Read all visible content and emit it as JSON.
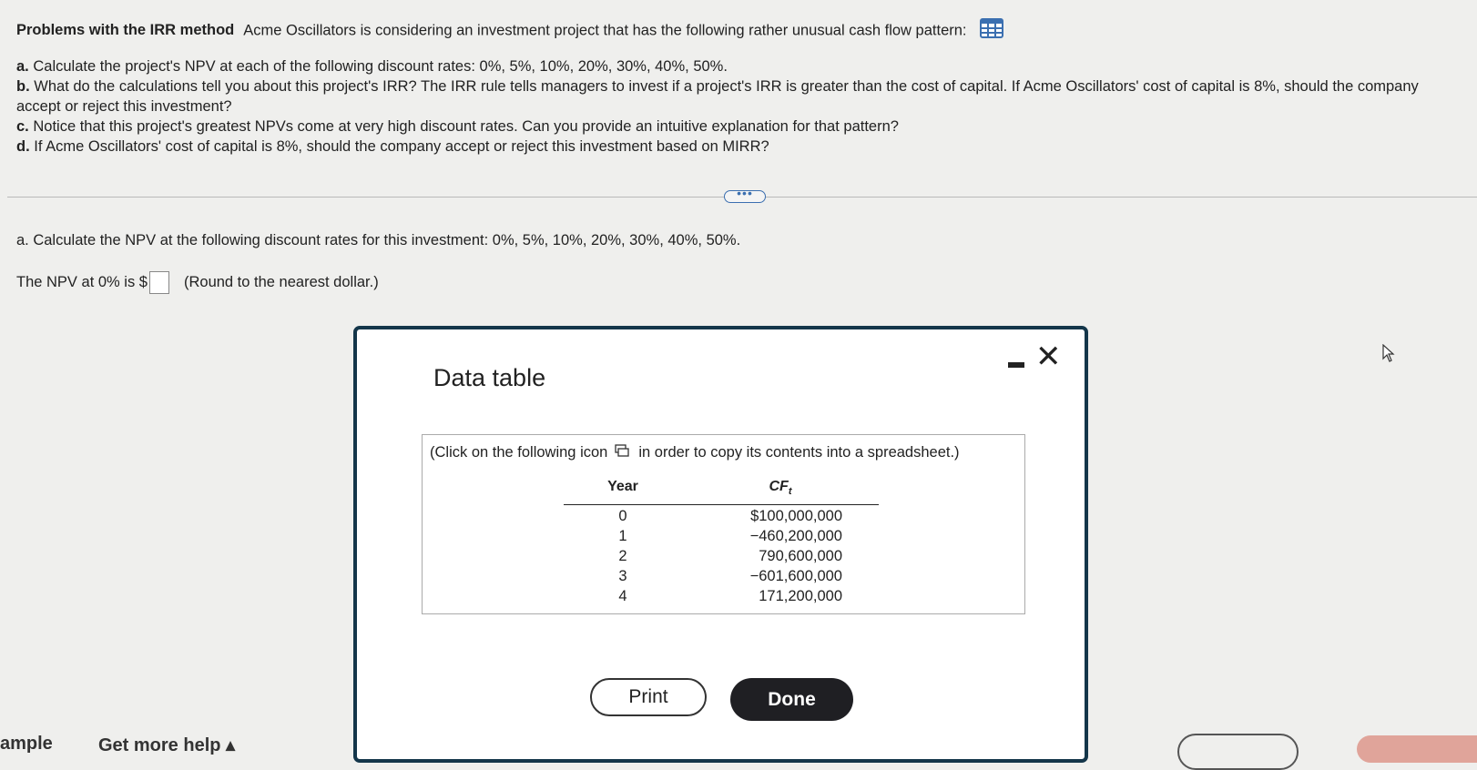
{
  "problem": {
    "title": "Problems with the IRR method",
    "intro": "Acme Oscillators is considering an investment project that has the following rather unusual cash flow pattern:",
    "data_icon": "table-grid-icon",
    "items": [
      {
        "letter": "a.",
        "text": "Calculate the project's NPV at each of the following discount rates: 0%, 5%, 10%, 20%, 30%, 40%, 50%."
      },
      {
        "letter": "b.",
        "text": "What do the calculations tell you about this project's IRR? The IRR rule tells managers to invest if a project's IRR is greater than the cost of capital. If Acme Oscillators' cost of capital is 8%, should the company accept or reject this investment?"
      },
      {
        "letter": "c.",
        "text": "Notice that this project's greatest NPVs come at very high discount rates. Can you provide an intuitive explanation for that pattern?"
      },
      {
        "letter": "d.",
        "text": "If Acme Oscillators' cost of capital is 8%, should the company accept or reject this investment based on MIRR?"
      }
    ]
  },
  "more_button": "•••",
  "part_a": {
    "text": "a. Calculate the NPV at the following discount rates for this investment: 0%, 5%, 10%, 20%, 30%, 40%, 50%.",
    "npv_prefix": "The NPV at 0% is $",
    "npv_value": "",
    "npv_suffix": "(Round to the nearest dollar.)"
  },
  "dialog": {
    "title": "Data table",
    "note_before": "(Click on the following icon",
    "note_after": "in order to copy its contents into a spreadsheet.)",
    "header_year": "Year",
    "header_cf": "CF",
    "header_cf_sub": "t",
    "rows": [
      {
        "year": "0",
        "cf": "$100,000,000"
      },
      {
        "year": "1",
        "cf": "−460,200,000"
      },
      {
        "year": "2",
        "cf": "790,600,000"
      },
      {
        "year": "3",
        "cf": "−601,600,000"
      },
      {
        "year": "4",
        "cf": "171,200,000"
      }
    ],
    "print_label": "Print",
    "done_label": "Done"
  },
  "footer": {
    "left_cut": "ample",
    "help": "Get more help ▴"
  },
  "colors": {
    "accent_blue": "#3b6fb0",
    "dialog_border": "#14364a",
    "done_bg": "#1f1f23",
    "partial_button": "#e0a49a"
  }
}
